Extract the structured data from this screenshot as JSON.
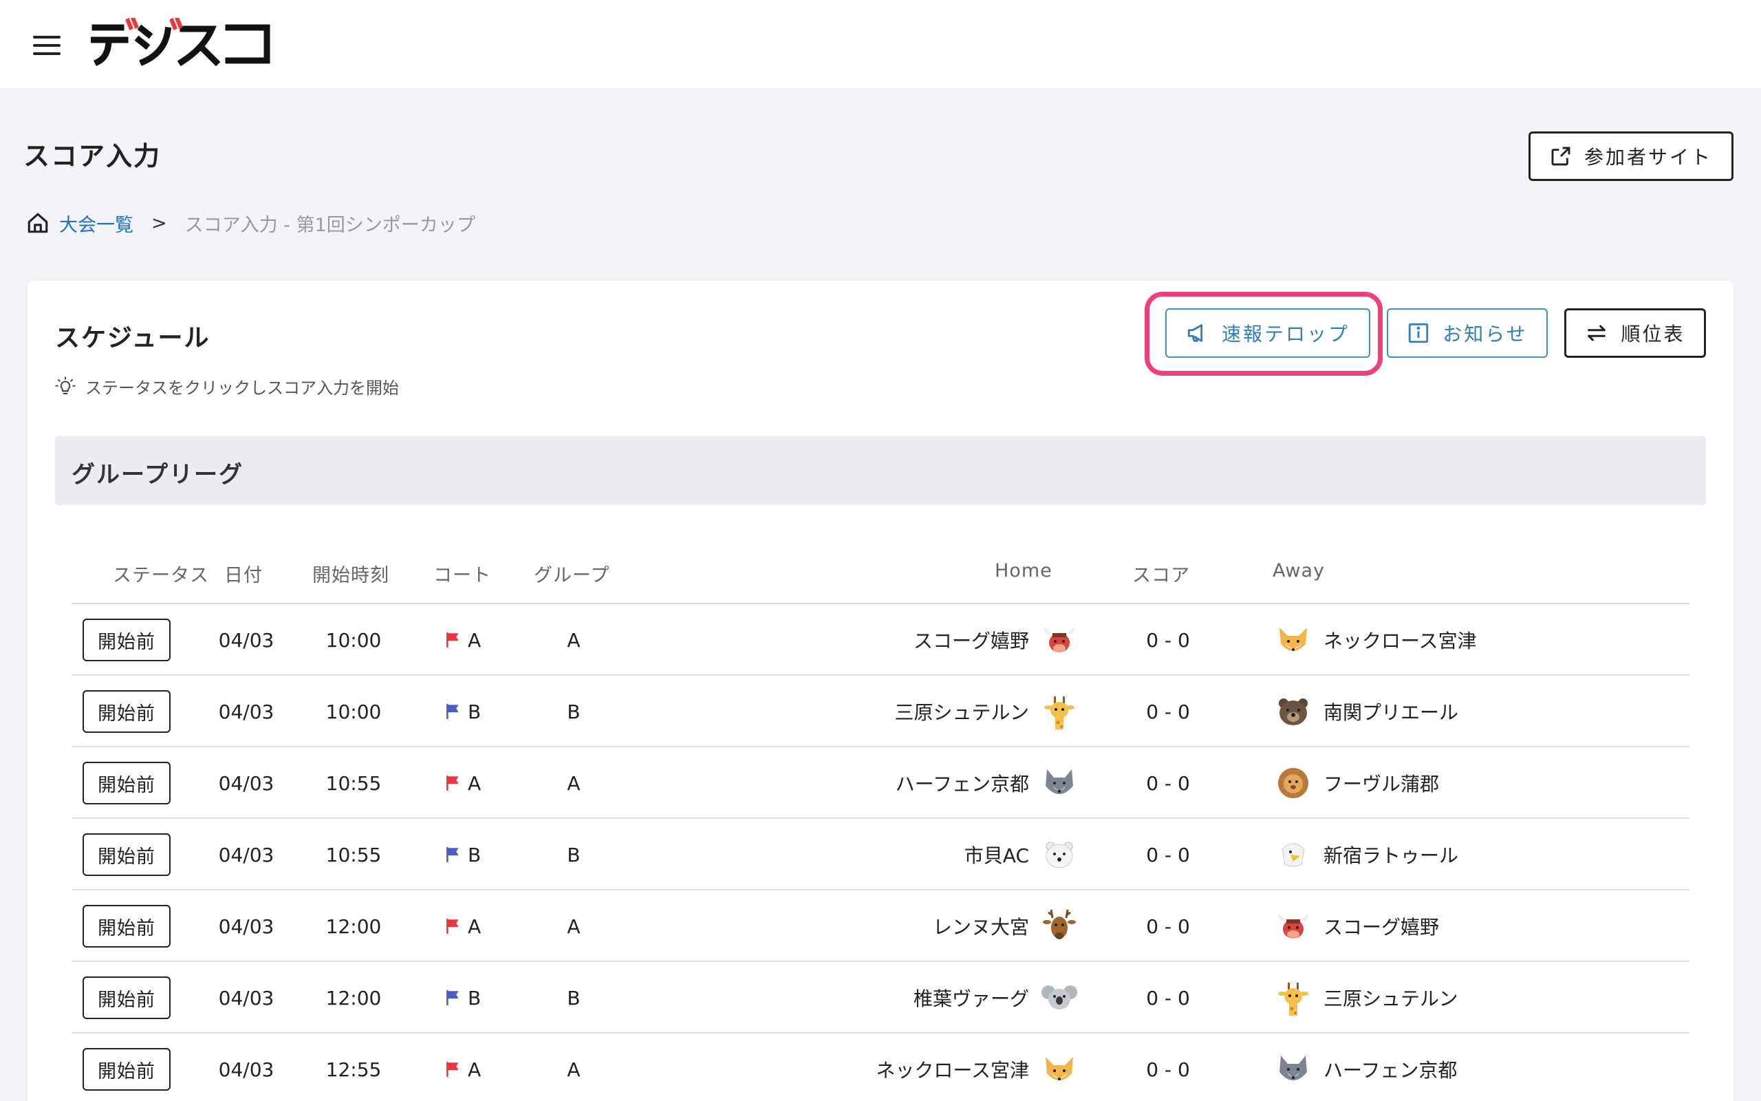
{
  "header": {
    "logo_text": "デジスコ"
  },
  "page": {
    "title": "スコア入力",
    "participant_button": "参加者サイト"
  },
  "breadcrumb": {
    "home": "大会一覧",
    "separator": ">",
    "current": "スコア入力 - 第1回シンポーカップ"
  },
  "schedule": {
    "title": "スケジュール",
    "hint": "ステータスをクリックしスコア入力を開始",
    "buttons": {
      "telop": "速報テロップ",
      "notice": "お知らせ",
      "standings": "順位表"
    },
    "section_title": "グループリーグ",
    "columns": {
      "status": "ステータス",
      "date": "日付",
      "time": "開始時刻",
      "court": "コート",
      "group": "グループ",
      "home": "Home",
      "score": "スコア",
      "away": "Away"
    },
    "rows": [
      {
        "status": "開始前",
        "date": "04/03",
        "time": "10:00",
        "court": "A",
        "group": "A",
        "home": "スコーグ嬉野",
        "home_icon": "bull",
        "score": "0 - 0",
        "away": "ネックロース宮津",
        "away_icon": "fox"
      },
      {
        "status": "開始前",
        "date": "04/03",
        "time": "10:00",
        "court": "B",
        "group": "B",
        "home": "三原シュテルン",
        "home_icon": "giraffe",
        "score": "0 - 0",
        "away": "南関プリエール",
        "away_icon": "bear"
      },
      {
        "status": "開始前",
        "date": "04/03",
        "time": "10:55",
        "court": "A",
        "group": "A",
        "home": "ハーフェン京都",
        "home_icon": "wolf",
        "score": "0 - 0",
        "away": "フーヴル蒲郡",
        "away_icon": "lion"
      },
      {
        "status": "開始前",
        "date": "04/03",
        "time": "10:55",
        "court": "B",
        "group": "B",
        "home": "市貝AC",
        "home_icon": "polar-bear",
        "score": "0 - 0",
        "away": "新宿ラトゥール",
        "away_icon": "eagle"
      },
      {
        "status": "開始前",
        "date": "04/03",
        "time": "12:00",
        "court": "A",
        "group": "A",
        "home": "レンヌ大宮",
        "home_icon": "deer",
        "score": "0 - 0",
        "away": "スコーグ嬉野",
        "away_icon": "bull"
      },
      {
        "status": "開始前",
        "date": "04/03",
        "time": "12:00",
        "court": "B",
        "group": "B",
        "home": "椎葉ヴァーグ",
        "home_icon": "koala",
        "score": "0 - 0",
        "away": "三原シュテルン",
        "away_icon": "giraffe"
      },
      {
        "status": "開始前",
        "date": "04/03",
        "time": "12:55",
        "court": "A",
        "group": "A",
        "home": "ネックロース宮津",
        "home_icon": "fox",
        "score": "0 - 0",
        "away": "ハーフェン京都",
        "away_icon": "wolf"
      }
    ]
  },
  "colors": {
    "court_A_flag": "#e8383d",
    "court_B_flag": "#4a5fc1",
    "highlight": "#f0407a",
    "link": "#1e6fd0",
    "accent_button": "#3f8fcf"
  }
}
